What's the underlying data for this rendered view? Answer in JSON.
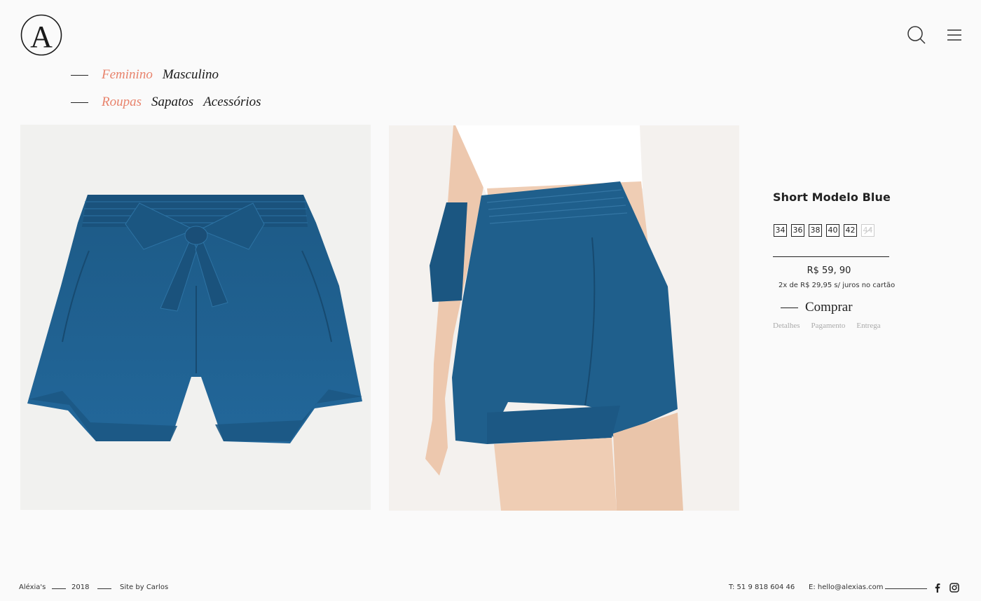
{
  "header": {
    "logo_letter": "A",
    "icons": [
      "search-icon",
      "menu-icon"
    ]
  },
  "nav": {
    "gender": [
      {
        "label": "Feminino",
        "active": true
      },
      {
        "label": "Masculino",
        "active": false
      }
    ],
    "category": [
      {
        "label": "Roupas",
        "active": true
      },
      {
        "label": "Sapatos",
        "active": false
      },
      {
        "label": "Acessórios",
        "active": false
      }
    ]
  },
  "product": {
    "title": "Short Modelo Blue",
    "sizes": [
      {
        "label": "34",
        "available": true
      },
      {
        "label": "36",
        "available": true
      },
      {
        "label": "38",
        "available": true
      },
      {
        "label": "40",
        "available": true
      },
      {
        "label": "42",
        "available": true
      },
      {
        "label": "44",
        "available": false
      }
    ],
    "price": "R$ 59, 90",
    "installments": "2x  de R$ 29,95 s/ juros no cartão",
    "buy_label": "Comprar",
    "tabs": [
      "Detalhes",
      "Pagamento",
      "Entrega"
    ]
  },
  "footer": {
    "brand": "Aléxia's",
    "year": "2018",
    "credit": "Site by Carlos",
    "phone": "T: 51 9 818 604 46",
    "email": "E: hello@alexias.com",
    "social_icons": [
      "facebook-icon",
      "instagram-icon"
    ]
  },
  "colors": {
    "accent": "#e8836c",
    "denim": "#1f5f8c",
    "background": "#fafafa",
    "text": "#1a1a1a"
  }
}
